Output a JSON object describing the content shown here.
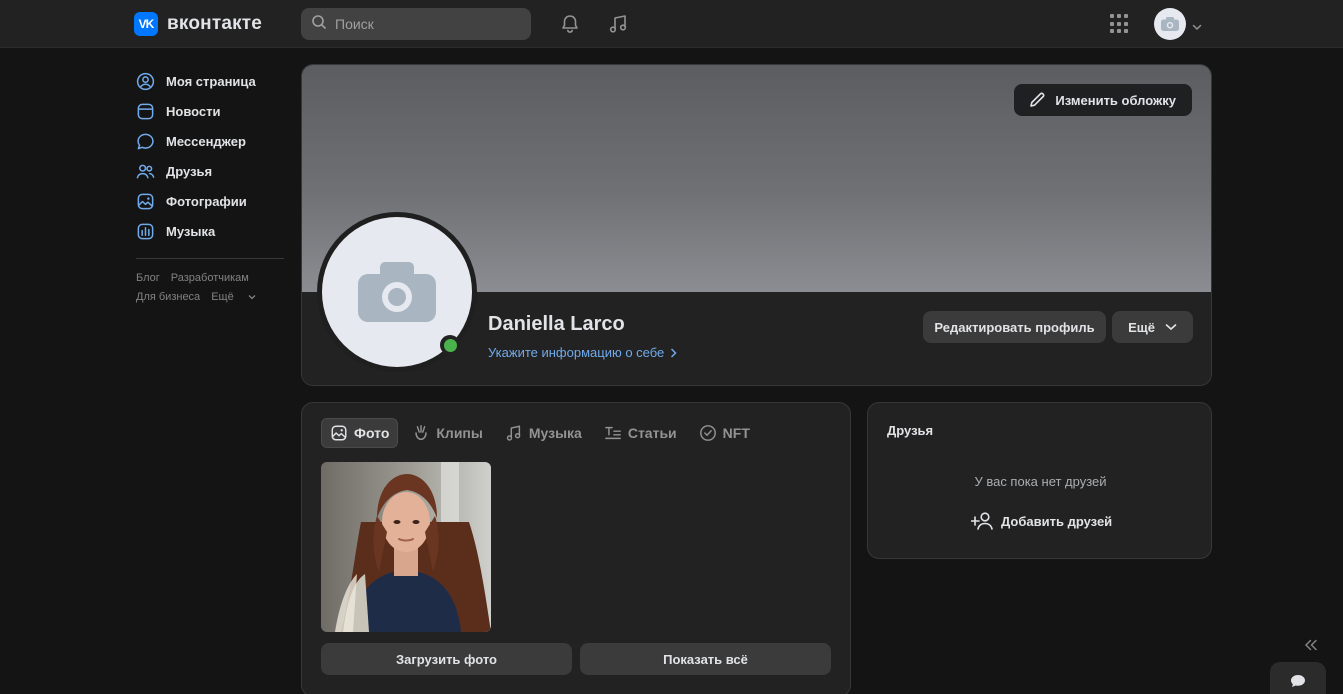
{
  "header": {
    "logo_mark": "VK",
    "logo_text": "вконтакте",
    "search_placeholder": "Поиск"
  },
  "sidebar": {
    "items": [
      {
        "label": "Моя страница",
        "icon": "user-circle-icon"
      },
      {
        "label": "Новости",
        "icon": "news-icon"
      },
      {
        "label": "Мессенджер",
        "icon": "message-icon"
      },
      {
        "label": "Друзья",
        "icon": "friends-icon"
      },
      {
        "label": "Фотографии",
        "icon": "photos-icon"
      },
      {
        "label": "Музыка",
        "icon": "music-icon"
      }
    ],
    "footer": {
      "blog": "Блог",
      "developers": "Разработчикам",
      "business": "Для бизнеса",
      "more": "Ещё"
    }
  },
  "profile": {
    "cover_button": "Изменить обложку",
    "name": "Daniella Larco",
    "about_link": "Укажите информацию о себе",
    "edit_button": "Редактировать профиль",
    "more_button": "Ещё",
    "online": true
  },
  "photos": {
    "tabs": [
      {
        "label": "Фото",
        "icon": "photo-icon",
        "active": true
      },
      {
        "label": "Клипы",
        "icon": "clips-icon",
        "active": false
      },
      {
        "label": "Музыка",
        "icon": "music-icon",
        "active": false
      },
      {
        "label": "Статьи",
        "icon": "articles-icon",
        "active": false
      },
      {
        "label": "NFT",
        "icon": "nft-icon",
        "active": false
      }
    ],
    "upload_button": "Загрузить фото",
    "show_all_button": "Показать всё"
  },
  "friends": {
    "title": "Друзья",
    "empty_text": "У вас пока нет друзей",
    "add_button": "Добавить друзей"
  },
  "colors": {
    "accent": "#0077ff",
    "link": "#71aaeb",
    "online": "#4bb34b"
  }
}
